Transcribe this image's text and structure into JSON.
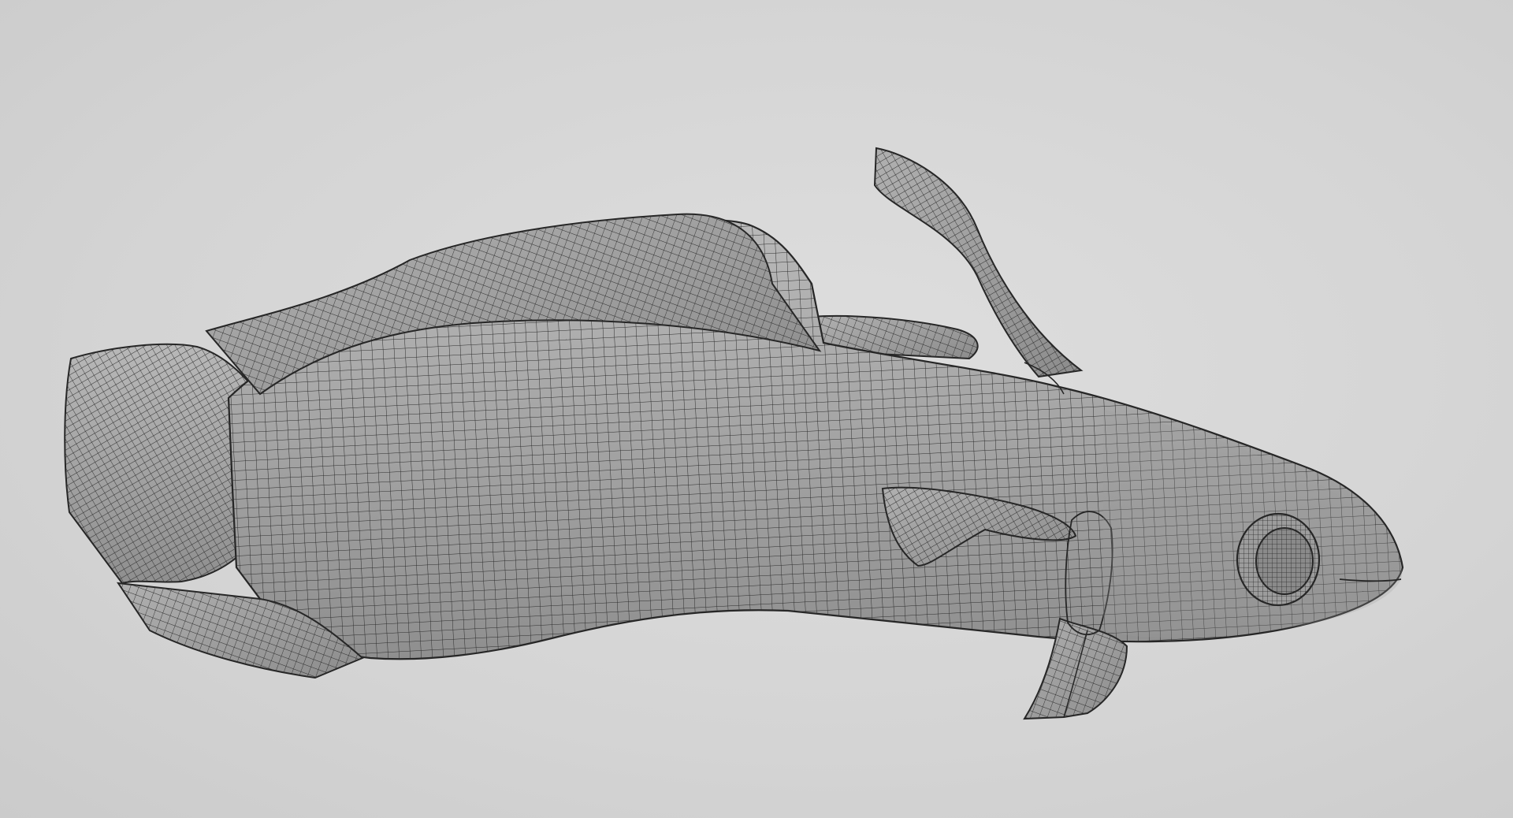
{
  "viewport": {
    "background_color": "#d6d6d6",
    "mesh_fill_color": "#a9a9a9",
    "mesh_wire_color": "#2a2a2a",
    "display_mode": "wireframe-on-shaded"
  },
  "model": {
    "subject": "fish",
    "parts": [
      "body",
      "head",
      "eye",
      "tail-fin",
      "dorsal-fin",
      "rear-dorsal-fin",
      "front-dorsal-ray",
      "pectoral-fin",
      "pelvic-fin",
      "anal-fin"
    ]
  }
}
